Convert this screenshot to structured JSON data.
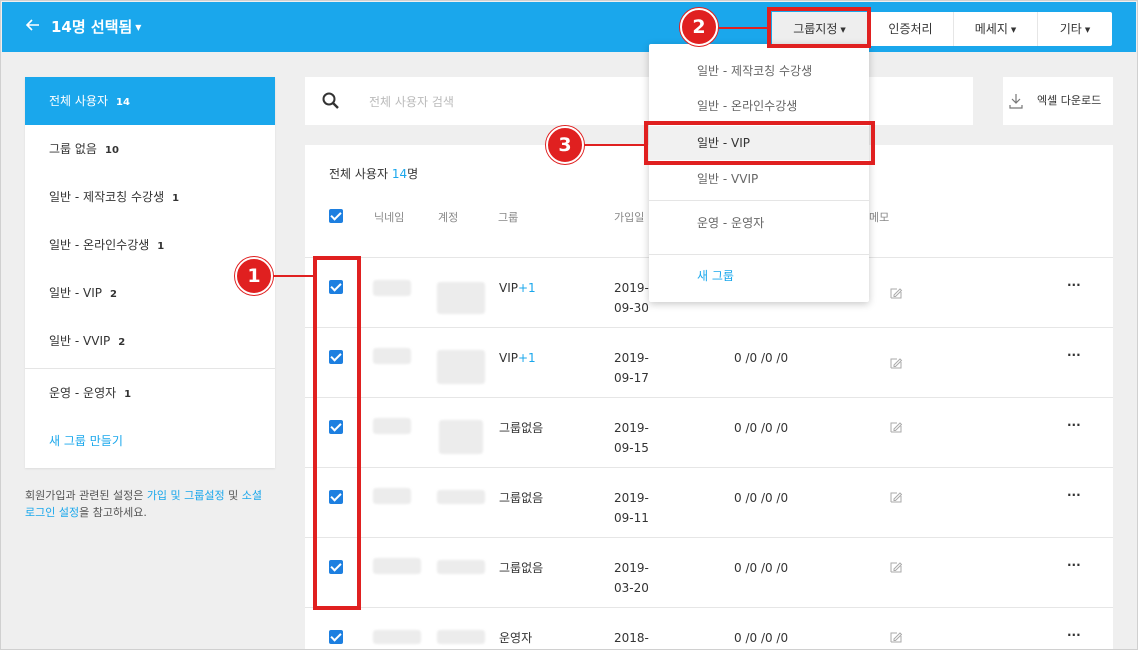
{
  "header": {
    "back_icon": "arrow-left-icon",
    "title": "14명 선택됨",
    "buttons": {
      "group_assign": "그룹지정",
      "auth": "인증처리",
      "message": "메세지",
      "etc": "기타"
    }
  },
  "sidebar": {
    "items": [
      {
        "label": "전체 사용자",
        "count": "14"
      },
      {
        "label": "그룹 없음",
        "count": "10"
      },
      {
        "label": "일반 - 제작코칭 수강생",
        "count": "1"
      },
      {
        "label": "일반 - 온라인수강생",
        "count": "1"
      },
      {
        "label": "일반 - VIP",
        "count": "2"
      },
      {
        "label": "일반 - VVIP",
        "count": "2"
      },
      {
        "label": "운영 - 운영자",
        "count": "1"
      }
    ],
    "new_group": "새 그룹 만들기",
    "note": {
      "prefix": "회원가입과 관련된 설정은 ",
      "link1": "가입 및 그룹설정",
      "mid": " 및 ",
      "link2a": "소셜",
      "link2b": "로그인 설정",
      "suffix": "을 참고하세요."
    }
  },
  "search": {
    "placeholder": "전체 사용자 검색"
  },
  "excel": {
    "label": "엑셀 다운로드"
  },
  "table": {
    "title_prefix": "전체 사용자 ",
    "count": "14",
    "title_suffix": "명",
    "headers": {
      "nickname": "닉네임",
      "account": "계정",
      "group": "그룹",
      "joined": "가입일",
      "memo": "메모"
    },
    "rows": [
      {
        "group": "VIP",
        "group_extra": "+1",
        "date1": "2019-",
        "date2": "09-30",
        "stats": ""
      },
      {
        "group": "VIP",
        "group_extra": "+1",
        "date1": "2019-",
        "date2": "09-17",
        "stats": "0 /0 /0 /0"
      },
      {
        "group": "그룹없음",
        "group_extra": "",
        "date1": "2019-",
        "date2": "09-15",
        "stats": "0 /0 /0 /0"
      },
      {
        "group": "그룹없음",
        "group_extra": "",
        "date1": "2019-",
        "date2": "09-11",
        "stats": "0 /0 /0 /0"
      },
      {
        "group": "그룹없음",
        "group_extra": "",
        "date1": "2019-",
        "date2": "03-20",
        "stats": "0 /0 /0 /0"
      },
      {
        "group": "운영자",
        "group_extra": "",
        "date1": "2018-",
        "date2": "",
        "stats": "0 /0 /0 /0"
      }
    ]
  },
  "dropdown": {
    "items": [
      "일반 - 제작코칭 수강생",
      "일반 - 온라인수강생",
      "일반 - VIP",
      "일반 - VVIP",
      "운영 - 운영자"
    ],
    "new_group": "새 그룹"
  },
  "annotations": {
    "b1": "1",
    "b2": "2",
    "b3": "3"
  },
  "colors": {
    "accent": "#1aa7ec",
    "annotation": "#e02020",
    "checkbox": "#1d7fe0"
  }
}
